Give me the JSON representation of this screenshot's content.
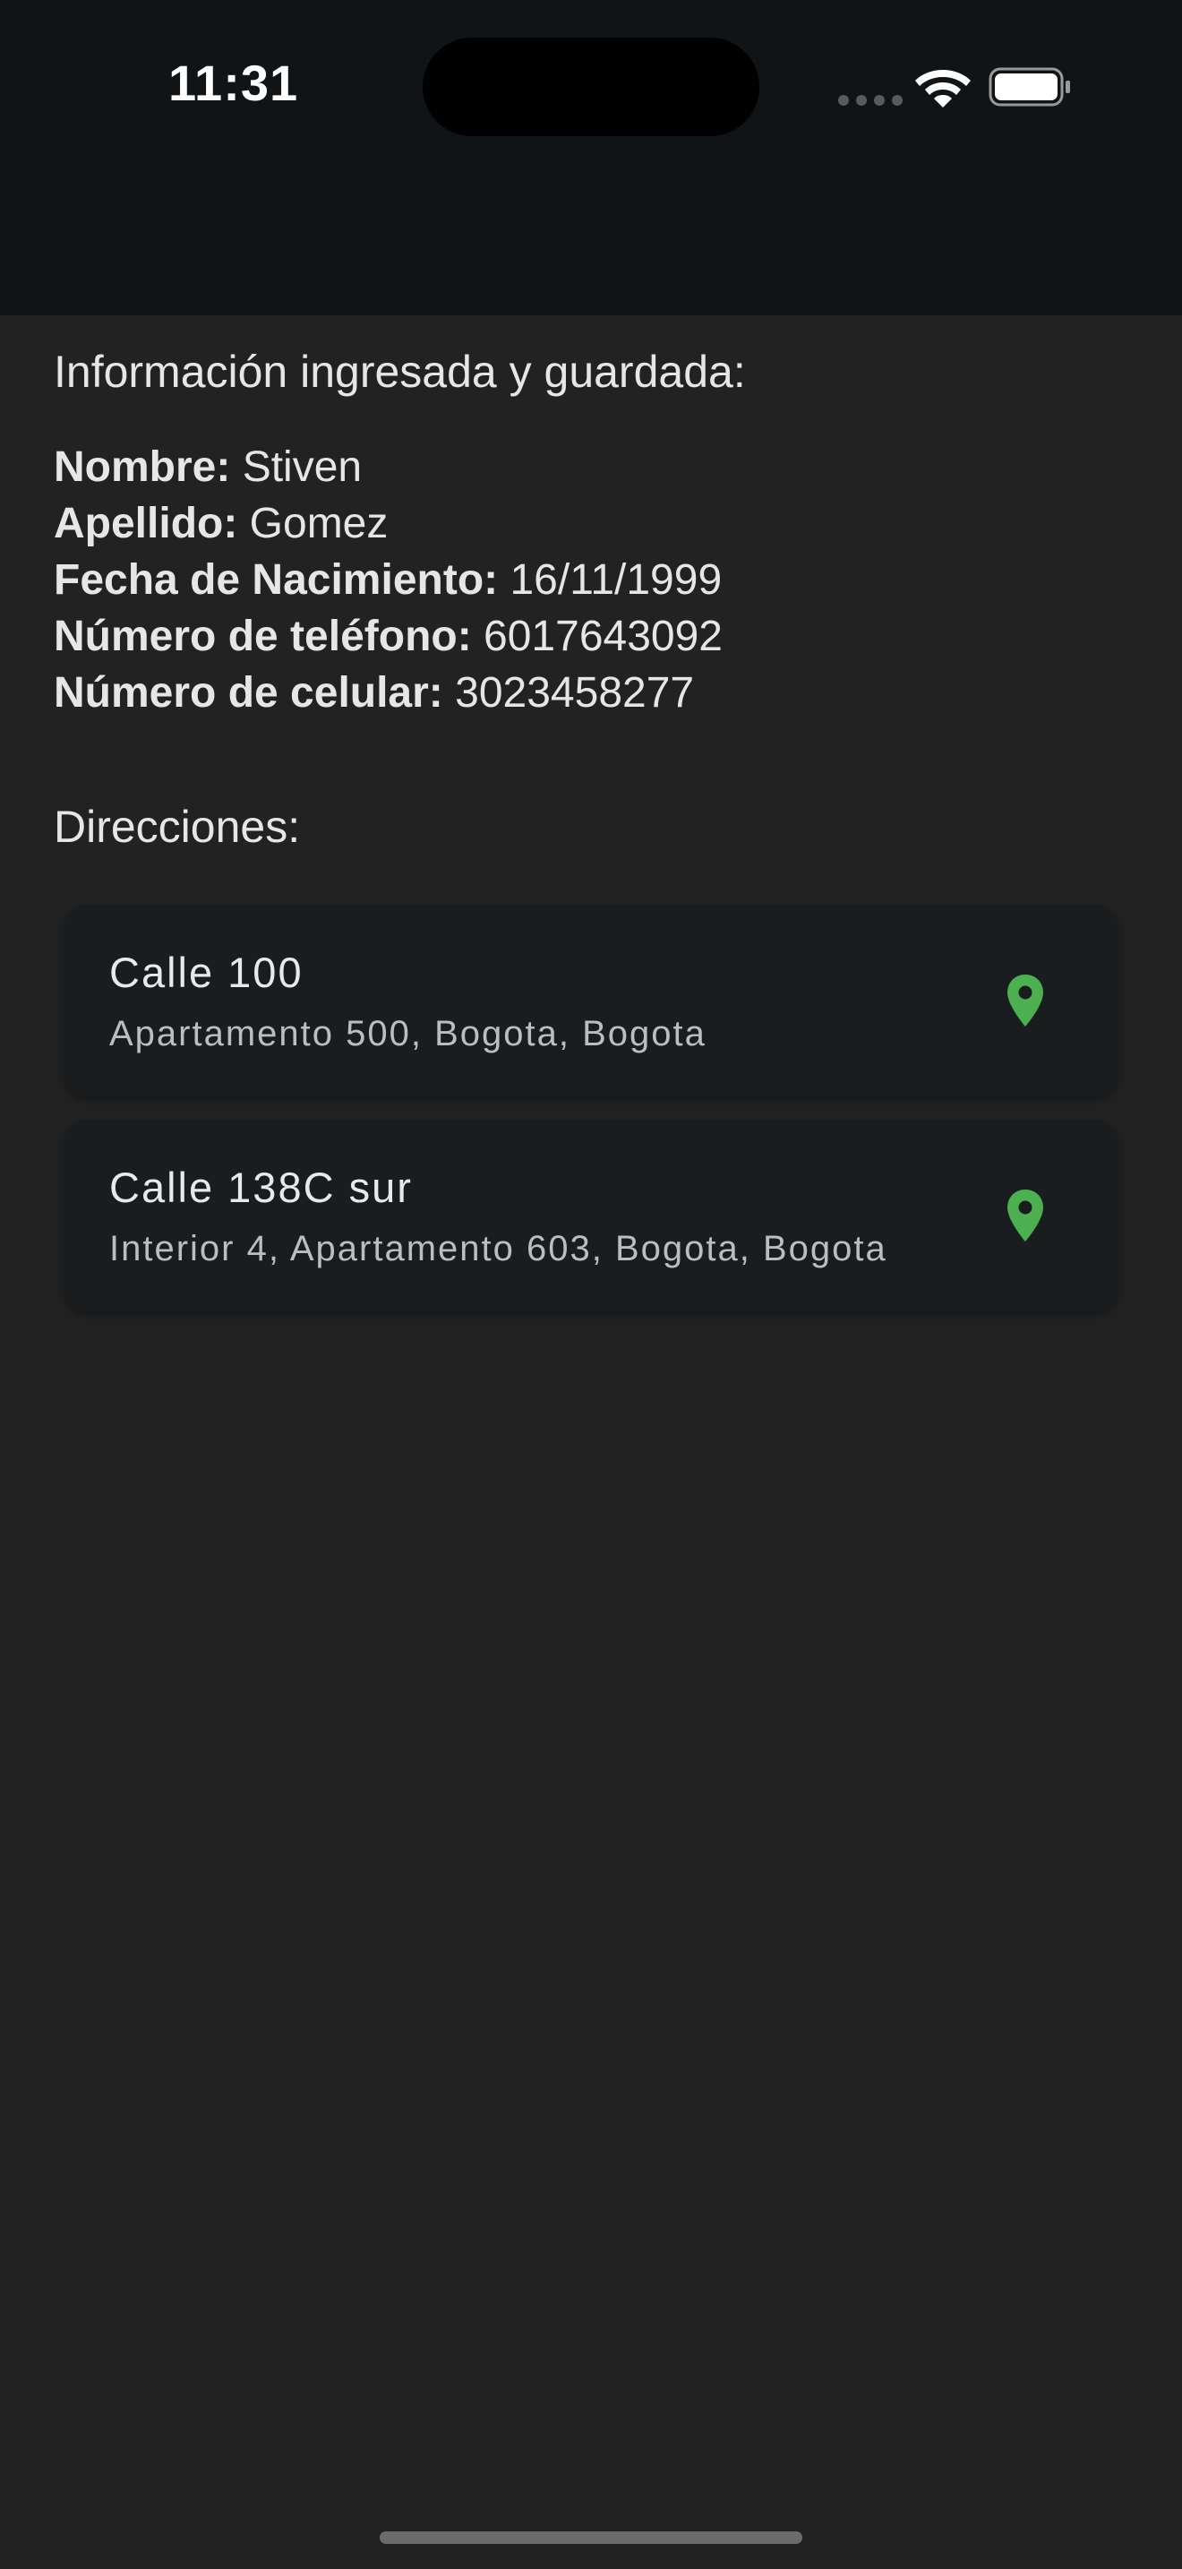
{
  "status_bar": {
    "time": "11:31"
  },
  "info": {
    "heading": "Información ingresada y guardada:",
    "rows": [
      {
        "label": "Nombre:",
        "value": "Stiven"
      },
      {
        "label": "Apellido:",
        "value": "Gomez"
      },
      {
        "label": "Fecha de Nacimiento:",
        "value": "16/11/1999"
      },
      {
        "label": "Número de teléfono:",
        "value": "6017643092"
      },
      {
        "label": "Número de celular:",
        "value": "3023458277"
      }
    ]
  },
  "directions": {
    "heading": "Direcciones:",
    "items": [
      {
        "street": "Calle 100",
        "details": "Apartamento 500, Bogota, Bogota",
        "icon": "location-pin-icon"
      },
      {
        "street": "Calle 138C sur",
        "details": "Interior 4, Apartamento 603, Bogota, Bogota",
        "icon": "location-pin-icon"
      }
    ]
  },
  "colors": {
    "background": "#222222",
    "top_bar": "#101417",
    "card": "#191d20",
    "pin": "#4caf50"
  }
}
